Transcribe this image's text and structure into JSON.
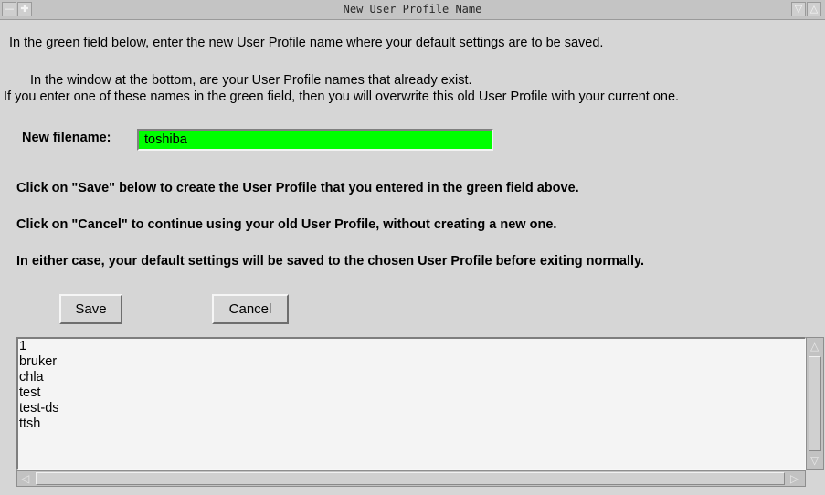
{
  "window": {
    "title": "New User Profile Name"
  },
  "titlebar_icons": {
    "menu": "menu-icon",
    "move": "move-icon",
    "minimize": "minimize-icon",
    "maximize": "maximize-icon"
  },
  "instructions": {
    "line1": "In the green field below, enter the new User Profile name where your default settings are to be saved.",
    "line2": "In the window at the bottom, are your User Profile names that already exist.",
    "line3": "If you enter one of these names in the green field, then you will overwrite this old User Profile with your current one."
  },
  "filename": {
    "label": "New filename:",
    "value": "toshiba"
  },
  "notes": {
    "save_note": "Click on \"Save\" below to create the User Profile that you entered in the green field above.",
    "cancel_note": "Click on \"Cancel\" to continue using your old User Profile, without creating a new one.",
    "either_note": "In either case, your default settings will be saved to the chosen User Profile before exiting normally."
  },
  "buttons": {
    "save_label": "Save",
    "cancel_label": "Cancel"
  },
  "profiles": [
    "1",
    "bruker",
    "chla",
    "test",
    "test-ds",
    "ttsh"
  ],
  "colors": {
    "input_background": "#00ff00",
    "window_background": "#d6d6d6"
  }
}
